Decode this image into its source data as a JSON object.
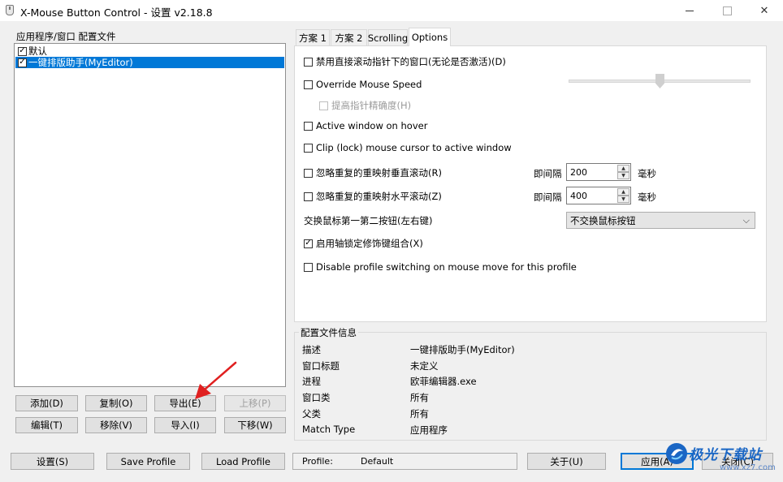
{
  "window": {
    "title": "X-Mouse Button Control - 设置 v2.18.8",
    "min_glyph": "—",
    "max_glyph": "☐",
    "close_glyph": "✕"
  },
  "left": {
    "group_label": "应用程序/窗口 配置文件",
    "profiles": [
      {
        "label": "默认",
        "checked": true,
        "selected": false
      },
      {
        "label": "一键排版助手(MyEditor)",
        "checked": true,
        "selected": true
      }
    ],
    "buttons": {
      "add": "添加(D)",
      "copy": "复制(O)",
      "export": "导出(E)",
      "move_up": "上移(P)",
      "edit": "编辑(T)",
      "remove": "移除(V)",
      "import": "导入(I)",
      "move_down": "下移(W)"
    }
  },
  "tabs": [
    "方案 1",
    "方案 2",
    "Scrolling",
    "Options"
  ],
  "options": {
    "disable_scroll_unfocused": "禁用直接滚动指针下的窗口(无论是否激活)(D)",
    "override_mouse_speed": "Override Mouse Speed",
    "enhance_precision": "提高指针精确度(H)",
    "active_window_hover": "Active window on hover",
    "clip_cursor": "Clip (lock) mouse cursor to active window",
    "ignore_vertical": "忽略重复的重映射垂直滚动(R)",
    "ignore_horizontal": "忽略重复的重映射水平滚动(Z)",
    "interval_label": "即间隔",
    "vertical_interval": "200",
    "horizontal_interval": "400",
    "ms_label": "毫秒",
    "swap_buttons_label": "交换鼠标第一第二按钮(左右键)",
    "swap_buttons_value": "不交换鼠标按钮",
    "axis_lock": "启用轴锁定修饰键组合(X)",
    "disable_profile_switching": "Disable profile switching on mouse move for this profile",
    "axis_lock_checked": true
  },
  "profile_info": {
    "label": "配置文件信息",
    "rows": [
      {
        "key": "描述",
        "value": "一键排版助手(MyEditor)"
      },
      {
        "key": "窗口标题",
        "value": "未定义"
      },
      {
        "key": "进程",
        "value": "欧菲编辑器.exe"
      },
      {
        "key": "窗口类",
        "value": "所有"
      },
      {
        "key": "父类",
        "value": "所有"
      },
      {
        "key": "Match Type",
        "value": "应用程序"
      }
    ]
  },
  "bottom": {
    "settings": "设置(S)",
    "save_profile": "Save Profile",
    "load_profile": "Load Profile",
    "profile_label": "Profile:",
    "profile_value": "Default",
    "about": "关于(U)",
    "apply": "应用(A)",
    "close": "关闭(C)"
  },
  "watermark": {
    "text": "极光下载站",
    "url": "www.xz7.com"
  },
  "colors": {
    "selection": "#0078d7",
    "annotation_arrow": "#e02020"
  }
}
